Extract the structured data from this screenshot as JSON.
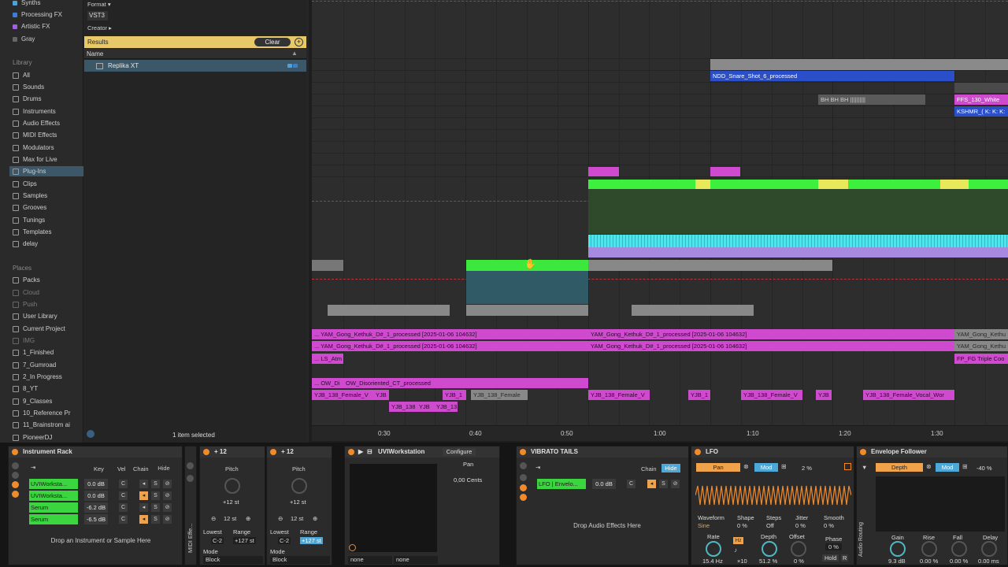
{
  "sidebar": {
    "colors": [
      {
        "label": "Synths",
        "color": "#4aa3e0"
      },
      {
        "label": "Processing FX",
        "color": "#3a7fd0"
      },
      {
        "label": "Artistic FX",
        "color": "#a060e0"
      },
      {
        "label": "Gray",
        "color": "#666666"
      }
    ],
    "library_header": "Library",
    "library": [
      "All",
      "Sounds",
      "Drums",
      "Instruments",
      "Audio Effects",
      "MIDI Effects",
      "Modulators",
      "Max for Live",
      "Plug-Ins",
      "Clips",
      "Samples",
      "Grooves",
      "Tunings",
      "Templates",
      "delay"
    ],
    "places_header": "Places",
    "places": [
      "Packs",
      "Cloud",
      "Push",
      "User Library",
      "Current Project",
      "IMG",
      "1_Finished",
      "7_Gumroad",
      "2_In Progress",
      "8_YT",
      "9_Classes",
      "10_Reference Pr",
      "11_Brainstrom ai",
      "PioneerDJ"
    ]
  },
  "browser": {
    "format_label": "Format",
    "vst3": "VST3",
    "creator_label": "Creator",
    "results_label": "Results",
    "clear_label": "Clear",
    "name_header": "Name",
    "result_item": "Replika XT",
    "status": "1 item selected"
  },
  "arrangement": {
    "clips": {
      "ndd": "NDD_Snare_Shot_6_processed",
      "bh": "BH BH BH ||||||||||",
      "ffs": "FFS_130_White",
      "kshmr": "KSHMR_( K: K: K:",
      "yam1": "... YAM_Gong_Kethuk_D#_1_processed [2025-01-06 104632]",
      "yam2": "YAM_Gong_Kethuk_D#_1_processed [2025-01-06 104632]",
      "yam3": "... YAM_Gong_Kethuk_D#_1_processed [2025-01-06 104632]",
      "yam4": "YAM_Gong_Kethuk_D#_1_processed [2025-01-06 104632]",
      "yam5": "YAM_Gong_Kethu",
      "yam6": "YAM_Gong_Kethu",
      "ls": "... LS_Atm",
      "fp": "FP_FG Triple Coo",
      "ow1": "... OW_Di",
      "ow2": "OW_Disoriented_CT_processed",
      "yjb1": "YJB_138_Female_V",
      "yjb2": "YJB",
      "yjb3": "YJB_1",
      "yjb4": "YJB_138_Female",
      "yjb5": "YJB_138_Female_V",
      "yjb6": "YJB_1",
      "yjb7": "YJB_138_Female_V",
      "yjb8": "YJB",
      "yjb9": "YJB_138_Female_Vocal_Wor",
      "yjb10": "YJB_138",
      "yjb11": "YJB",
      "yjb12": "YJB_13"
    },
    "ruler": [
      "0:30",
      "0:40",
      "0:50",
      "1:00",
      "1:10",
      "1:20",
      "1:30"
    ]
  },
  "devices": {
    "rack": {
      "title": "Instrument Rack",
      "key": "Key",
      "vel": "Vel",
      "chain": "Chain",
      "hide": "Hide",
      "drop": "Drop an Instrument or Sample Here",
      "chains": [
        {
          "name": "UVIWorksta...",
          "vol": "0.0 dB"
        },
        {
          "name": "UVIWorksta...",
          "vol": "0.0 dB"
        },
        {
          "name": "Serum",
          "vol": "-6.2 dB"
        },
        {
          "name": "Serum",
          "vol": "-6.5 dB"
        }
      ],
      "c": "C",
      "s": "S"
    },
    "midi_label": "MIDI Effe...",
    "pitch1": {
      "title": "+ 12",
      "label": "Pitch",
      "value": "+12 st",
      "step": "12 st",
      "lowest": "Lowest",
      "range": "Range",
      "low_val": "C-2",
      "range_val": "+127 st",
      "mode": "Mode",
      "mode_val": "Block"
    },
    "pitch2": {
      "title": "+ 12",
      "label": "Pitch",
      "value": "+12 st",
      "step": "12 st",
      "lowest": "Lowest",
      "range": "Range",
      "low_val": "C-2",
      "range_val": "+127 st",
      "mode": "Mode",
      "mode_val": "Block"
    },
    "uvi": {
      "title": "UVIWorkstation",
      "configure": "Configure",
      "pan": "Pan",
      "cents": "0,00 Cents",
      "none1": "none",
      "none2": "none"
    },
    "vibrato": {
      "title": "VIBRATO TAILS",
      "chain": "Chain",
      "hide": "Hide",
      "chain_name": "LFO | Envelo...",
      "vol": "0.0 dB",
      "c": "C",
      "s": "S",
      "drop": "Drop Audio Effects Here"
    },
    "lfo": {
      "title": "LFO",
      "pan": "Pan",
      "mod": "Mod",
      "pct": "2 %",
      "waveform": "Waveform",
      "wave_val": "Sine",
      "shape": "Shape",
      "shape_val": "0 %",
      "steps": "Steps",
      "steps_val": "Off",
      "jitter": "Jitter",
      "jitter_val": "0 %",
      "smooth": "Smooth",
      "smooth_val": "0 %",
      "rate": "Rate",
      "rate_val": "15.4 Hz",
      "hz": "Hz",
      "x10": "×10",
      "depth": "Depth",
      "depth_val": "51.2 %",
      "offset": "Offset",
      "offset_val": "0 %",
      "phase": "Phase",
      "phase_val": "0 %",
      "hold": "Hold",
      "r": "R"
    },
    "env": {
      "title": "Envelope Follower",
      "depth": "Depth",
      "mod": "Mod",
      "pct": "-40 %",
      "gain": "Gain",
      "gain_val": "9.3 dB",
      "rise": "Rise",
      "rise_val": "0.00 %",
      "fall": "Fall",
      "fall_val": "0.00 %",
      "delay": "Delay",
      "delay_val": "0.00 ms",
      "routing": "Audio Routing"
    }
  }
}
